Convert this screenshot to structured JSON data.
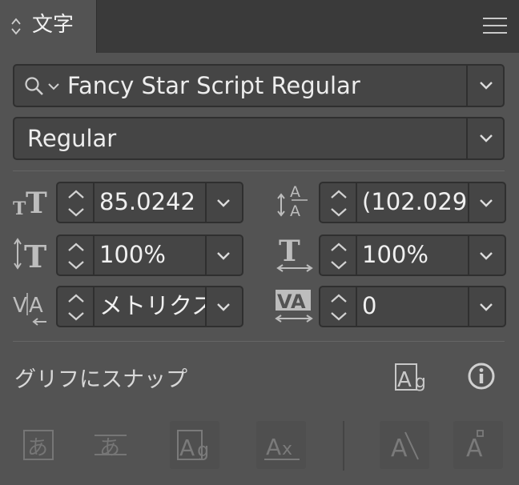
{
  "panel": {
    "tab_title": "文字",
    "menu_icon": "hamburger-menu-icon"
  },
  "font": {
    "family": "Fancy Star Script Regular",
    "style": "Regular",
    "search_icon": "search-icon"
  },
  "fields": {
    "font_size": "85.0242",
    "leading": "(102.029",
    "vertical_scale": "100%",
    "horizontal_scale": "100%",
    "kerning": "メトリクス",
    "tracking": "0"
  },
  "snap": {
    "label": "グリフにスナップ"
  },
  "colors": {
    "panel_bg": "#535353",
    "field_bg": "#454545",
    "tab_bar_bg": "#3a3a3a",
    "text": "#e6e6e6"
  }
}
